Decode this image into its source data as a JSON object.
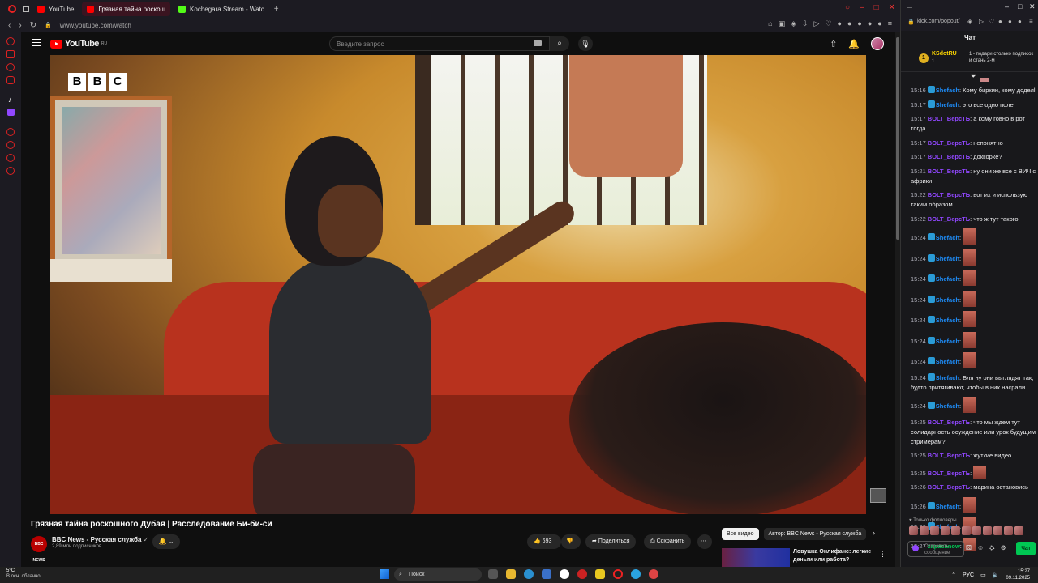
{
  "browser": {
    "tabs": [
      {
        "label": "YouTube",
        "color": "#ff0000"
      },
      {
        "label": "Грязная тайна роскош",
        "color": "#ff0000"
      },
      {
        "label": "Kochegara Stream - Watc",
        "color": "#53fc18"
      }
    ],
    "url": "www.youtube.com/watch"
  },
  "youtube": {
    "logo_text": "YouTube",
    "logo_region": "RU",
    "search_placeholder": "Введите запрос",
    "video_title": "Грязная тайна роскошного Дубая | Расследование Би-би-си",
    "channel_name": "BBC News - Русская служба",
    "channel_avatar_text": "BBC NEWS",
    "subscribers": "2,89 млн подписчиков",
    "likes": "693",
    "share_label": "Поделиться",
    "save_label": "Сохранить",
    "chips": [
      "Все видео",
      "Автор: BBC News - Русская служба"
    ],
    "rec_title": "Ловушка Онлифанс: легкие деньги или работа?",
    "bbc_letters": [
      "B",
      "B",
      "C"
    ]
  },
  "chat": {
    "url": "kick.com/popout/",
    "header": "Чат",
    "pinned_user": "KSdotRU",
    "pinned_count": "1",
    "pinned_text": "1 - подари столько подписок и стань 2-м",
    "messages": [
      {
        "time": "15:16",
        "user": "Shefach",
        "role": "s",
        "text": ": Кому биркин, кому доделl"
      },
      {
        "time": "15:17",
        "user": "Shefach",
        "role": "s",
        "text": ": это все одно поле"
      },
      {
        "time": "15:17",
        "user": "BOLT_ВерсТЬ",
        "role": "b",
        "text": ": а кому говно в рот тогда"
      },
      {
        "time": "15:17",
        "user": "BOLT_ВерсТЬ",
        "role": "b",
        "text": ": непонятно"
      },
      {
        "time": "15:17",
        "user": "BOLT_ВерсТЬ",
        "role": "b",
        "text": ": доккорке?"
      },
      {
        "time": "15:21",
        "user": "BOLT_ВерсТЬ",
        "role": "b",
        "text": ": ну они же все с ВИЧ с африки"
      },
      {
        "time": "15:22",
        "user": "BOLT_ВерсТЬ",
        "role": "b",
        "text": ": вот их и использую таким образом"
      },
      {
        "time": "15:22",
        "user": "BOLT_ВерсТЬ",
        "role": "b",
        "text": ": что ж тут такого"
      },
      {
        "time": "15:24",
        "user": "Shefach",
        "role": "s",
        "text": ":",
        "emote": true
      },
      {
        "time": "15:24",
        "user": "Shefach",
        "role": "s",
        "text": ":",
        "emote": true
      },
      {
        "time": "15:24",
        "user": "Shefach",
        "role": "s",
        "text": ":",
        "emote": true
      },
      {
        "time": "15:24",
        "user": "Shefach",
        "role": "s",
        "text": ":",
        "emote": true
      },
      {
        "time": "15:24",
        "user": "Shefach",
        "role": "s",
        "text": ":",
        "emote": true
      },
      {
        "time": "15:24",
        "user": "Shefach",
        "role": "s",
        "text": ":",
        "emote": true
      },
      {
        "time": "15:24",
        "user": "Shefach",
        "role": "s",
        "text": ":",
        "emote": true
      },
      {
        "time": "15:24",
        "user": "Shefach",
        "role": "s",
        "text": ": Бля ну они выглядят так, будто притягивают, чтобы в них насрали"
      },
      {
        "time": "15:24",
        "user": "Shefach",
        "role": "s",
        "text": ":",
        "emote": true
      },
      {
        "time": "15:25",
        "user": "BOLT_ВерсТЬ",
        "role": "b",
        "text": ": что мы ждем тут солидарность осуждение или урок будущим стримерам?"
      },
      {
        "time": "15:25",
        "user": "BOLT_ВерсТЬ",
        "role": "b",
        "text": ": жуткие видео"
      },
      {
        "time": "15:25",
        "user": "BOLT_ВерсТЬ",
        "role": "b",
        "text": ":",
        "emote": true
      },
      {
        "time": "15:26",
        "user": "BOLT_ВерсТЬ",
        "role": "b",
        "text": ": марина остановись"
      },
      {
        "time": "15:26",
        "user": "Shefach",
        "role": "s",
        "text": ":",
        "emote": true
      },
      {
        "time": "15:26",
        "user": "Shefach",
        "role": "s",
        "text": ":",
        "emote": true
      },
      {
        "time": "15:27",
        "user": "zapacanow",
        "role": "z",
        "text": ":",
        "emote": true
      }
    ],
    "followers_only": "Только фолловеры",
    "input_placeholder": "Отправить сообщение",
    "send_label": "Чат"
  },
  "taskbar": {
    "temp": "5°C",
    "weather": "В осн. облачно",
    "search_label": "Поиск",
    "lang": "РУС",
    "time": "15:27",
    "date": "09.11.2025"
  }
}
